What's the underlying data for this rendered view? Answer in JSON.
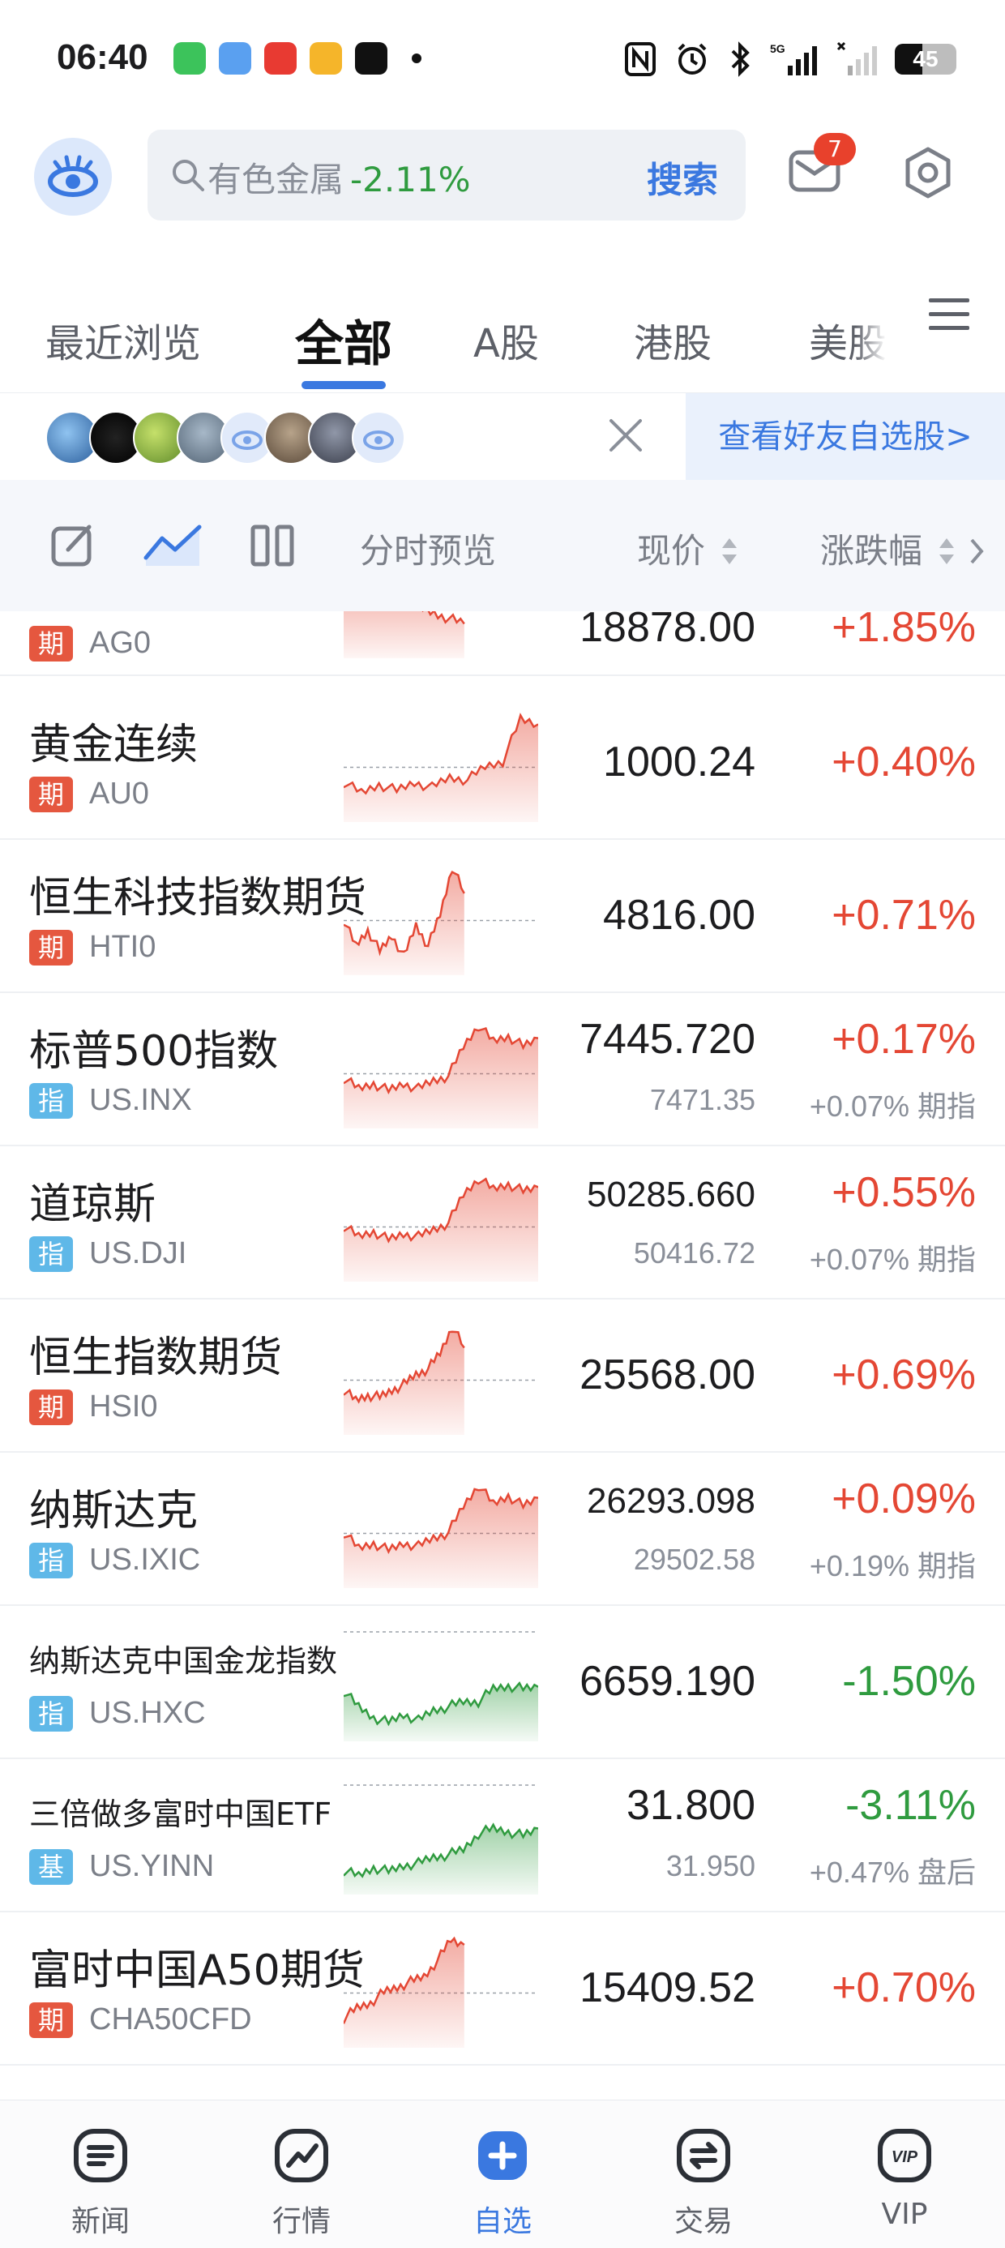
{
  "status_bar": {
    "time": "06:40",
    "battery": "45",
    "network": "5G"
  },
  "header": {
    "search_placeholder": "有色金属",
    "search_change": "-2.11%",
    "search_button": "搜索",
    "mail_badge": "7"
  },
  "tabs": [
    {
      "label": "最近浏览"
    },
    {
      "label": "全部"
    },
    {
      "label": "A股"
    },
    {
      "label": "港股"
    },
    {
      "label": "美股"
    }
  ],
  "friend_banner": {
    "link_label": "查看好友自选股>"
  },
  "toolbar": {
    "preview_label": "分时预览",
    "price_label": "现价",
    "change_label": "涨跌幅"
  },
  "rows": [
    {
      "name": "",
      "tag": "期",
      "code": "AG0",
      "price": "18878.00",
      "change": "+1.85%",
      "dir": "up",
      "sub_price": "",
      "sub_change": ""
    },
    {
      "name": "黄金连续",
      "tag": "期",
      "code": "AU0",
      "price": "1000.24",
      "change": "+0.40%",
      "dir": "up",
      "sub_price": "",
      "sub_change": ""
    },
    {
      "name": "恒生科技指数期货",
      "tag": "期",
      "code": "HTI0",
      "price": "4816.00",
      "change": "+0.71%",
      "dir": "up",
      "sub_price": "",
      "sub_change": ""
    },
    {
      "name": "标普500指数",
      "tag": "指",
      "code": "US.INX",
      "price": "7445.720",
      "change": "+0.17%",
      "dir": "up",
      "sub_price": "7471.35",
      "sub_change": "+0.07% 期指"
    },
    {
      "name": "道琼斯",
      "tag": "指",
      "code": "US.DJI",
      "price": "50285.660",
      "change": "+0.55%",
      "dir": "up",
      "sub_price": "50416.72",
      "sub_change": "+0.07% 期指"
    },
    {
      "name": "恒生指数期货",
      "tag": "期",
      "code": "HSI0",
      "price": "25568.00",
      "change": "+0.69%",
      "dir": "up",
      "sub_price": "",
      "sub_change": ""
    },
    {
      "name": "纳斯达克",
      "tag": "指",
      "code": "US.IXIC",
      "price": "26293.098",
      "change": "+0.09%",
      "dir": "up",
      "sub_price": "29502.58",
      "sub_change": "+0.19% 期指"
    },
    {
      "name": "纳斯达克中国金龙指数",
      "tag": "指",
      "code": "US.HXC",
      "price": "6659.190",
      "change": "-1.50%",
      "dir": "down",
      "sub_price": "",
      "sub_change": ""
    },
    {
      "name": "三倍做多富时中国ETF",
      "tag": "基",
      "code": "US.YINN",
      "price": "31.800",
      "change": "-3.11%",
      "dir": "down",
      "sub_price": "31.950",
      "sub_change": "+0.47% 盘后"
    },
    {
      "name": "富时中国A50期货",
      "tag": "期",
      "code": "CHA50CFD",
      "price": "15409.52",
      "change": "+0.70%",
      "dir": "up",
      "sub_price": "",
      "sub_change": ""
    }
  ],
  "bottom_nav": [
    {
      "label": "新闻",
      "icon": "news-icon"
    },
    {
      "label": "行情",
      "icon": "market-icon"
    },
    {
      "label": "自选",
      "icon": "add-icon"
    },
    {
      "label": "交易",
      "icon": "trade-icon"
    },
    {
      "label": "VIP",
      "icon": "vip-icon"
    }
  ],
  "colors": {
    "up": "#e44734",
    "down": "#2f9b3f",
    "accent": "#3a78e0"
  }
}
